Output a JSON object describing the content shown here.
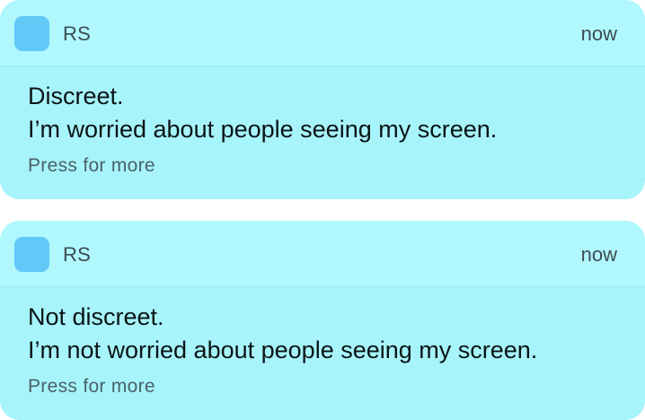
{
  "colors": {
    "card_background": "#a7f4fb",
    "header_background": "#b0f8fe",
    "app_icon": "#62c8f7",
    "page_background": "#ffffff"
  },
  "notifications": [
    {
      "app_icon": "app-icon",
      "app_name": "RS",
      "time": "now",
      "title": "Discreet.",
      "message": "I’m worried about people seeing my screen.",
      "more_label": "Press for more"
    },
    {
      "app_icon": "app-icon",
      "app_name": "RS",
      "time": "now",
      "title": "Not discreet.",
      "message": "I’m not worried about people seeing my screen.",
      "more_label": "Press for more"
    }
  ]
}
